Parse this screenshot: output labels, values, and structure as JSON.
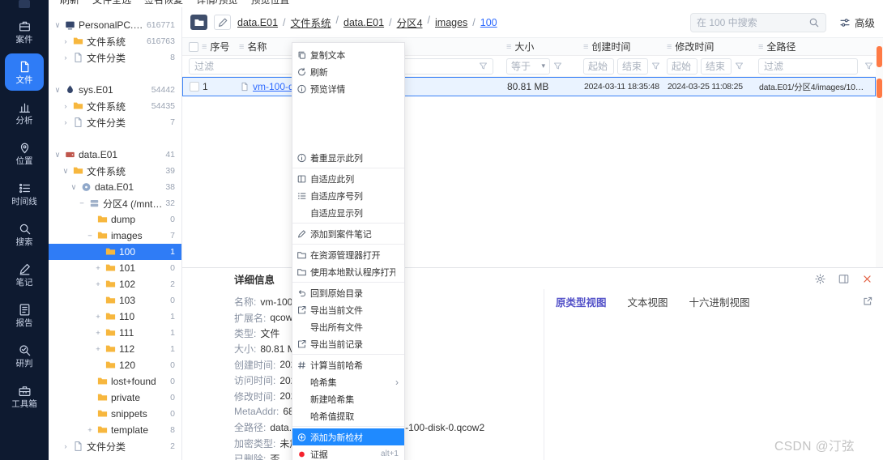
{
  "watermark": "CSDN @汀弦",
  "colors": {
    "accent_blue": "#2f7cf6",
    "menu_highlight": "#1f8aff",
    "link_blue": "#2f6bff",
    "folder_yellow": "#f7b73e",
    "evidence_red": "#f5222d",
    "scrollbar_orange": "#ff7a45",
    "tab_purple": "#5553c9",
    "rail_bg": "#0e1a30"
  },
  "top_toolbar": {
    "items": [
      {
        "label": "刷新"
      },
      {
        "label": "文件全选"
      },
      {
        "label": "签名恢复"
      },
      {
        "label": "详情/预览"
      },
      {
        "label": "预览位置"
      }
    ]
  },
  "rail": {
    "items": [
      {
        "label": "案件",
        "icon": "case-icon"
      },
      {
        "label": "文件",
        "icon": "file-icon",
        "active": true
      },
      {
        "label": "分析",
        "icon": "analysis-icon"
      },
      {
        "label": "位置",
        "icon": "location-icon"
      },
      {
        "label": "时间线",
        "icon": "timeline-icon"
      },
      {
        "label": "搜索",
        "icon": "search-icon"
      },
      {
        "label": "笔记",
        "icon": "note-icon"
      },
      {
        "label": "报告",
        "icon": "report-icon"
      },
      {
        "label": "研判",
        "icon": "judge-icon"
      },
      {
        "label": "工具箱",
        "icon": "toolbox-icon"
      }
    ]
  },
  "tree": {
    "nodes": [
      {
        "exp": "∨",
        "icon": "computer-icon",
        "label": "PersonalPC.E01",
        "count": "616771",
        "depth": 0
      },
      {
        "exp": "›",
        "icon": "folder-icon",
        "label": "文件系统",
        "count": "616763",
        "depth": 1
      },
      {
        "exp": "›",
        "icon": "doc-icon",
        "label": "文件分类",
        "count": "8",
        "depth": 1
      },
      {
        "exp": "∨",
        "icon": "drop-icon",
        "label": "sys.E01",
        "count": "54442",
        "depth": 0,
        "gap": true
      },
      {
        "exp": "›",
        "icon": "folder-icon",
        "label": "文件系统",
        "count": "54435",
        "depth": 1
      },
      {
        "exp": "›",
        "icon": "doc-icon",
        "label": "文件分类",
        "count": "7",
        "depth": 1
      },
      {
        "exp": "∨",
        "icon": "drive-red-icon",
        "label": "data.E01",
        "count": "41",
        "depth": 0,
        "gap": true
      },
      {
        "exp": "∨",
        "icon": "folder-icon",
        "label": "文件系统",
        "count": "39",
        "depth": 1
      },
      {
        "exp": "∨",
        "icon": "cd-icon",
        "label": "data.E01",
        "count": "38",
        "depth": 2
      },
      {
        "exp": "−",
        "icon": "partition-icon",
        "label": "分区4 (/mnt/p...",
        "count": "32",
        "depth": 3
      },
      {
        "exp": "",
        "icon": "folder-icon",
        "label": "dump",
        "count": "0",
        "depth": 4
      },
      {
        "exp": "−",
        "icon": "folder-icon",
        "label": "images",
        "count": "7",
        "depth": 4
      },
      {
        "exp": "",
        "icon": "folder-icon",
        "label": "100",
        "count": "1",
        "depth": 5,
        "selected": true
      },
      {
        "exp": "+",
        "icon": "folder-icon",
        "label": "101",
        "count": "0",
        "depth": 5
      },
      {
        "exp": "+",
        "icon": "folder-icon",
        "label": "102",
        "count": "2",
        "depth": 5
      },
      {
        "exp": "",
        "icon": "folder-icon",
        "label": "103",
        "count": "0",
        "depth": 5
      },
      {
        "exp": "+",
        "icon": "folder-icon",
        "label": "110",
        "count": "1",
        "depth": 5
      },
      {
        "exp": "+",
        "icon": "folder-icon",
        "label": "111",
        "count": "1",
        "depth": 5
      },
      {
        "exp": "+",
        "icon": "folder-icon",
        "label": "112",
        "count": "1",
        "depth": 5
      },
      {
        "exp": "",
        "icon": "folder-icon",
        "label": "120",
        "count": "0",
        "depth": 5
      },
      {
        "exp": "",
        "icon": "folder-icon",
        "label": "lost+found",
        "count": "0",
        "depth": 4
      },
      {
        "exp": "",
        "icon": "folder-icon",
        "label": "private",
        "count": "0",
        "depth": 4
      },
      {
        "exp": "",
        "icon": "folder-icon",
        "label": "snippets",
        "count": "0",
        "depth": 4
      },
      {
        "exp": "+",
        "icon": "folder-icon",
        "label": "template",
        "count": "8",
        "depth": 4
      },
      {
        "exp": "›",
        "icon": "doc-icon",
        "label": "文件分类",
        "count": "2",
        "depth": 1
      }
    ]
  },
  "breadcrumb": {
    "segments": [
      {
        "label": "data.E01"
      },
      {
        "label": "文件系统"
      },
      {
        "label": "data.E01"
      },
      {
        "label": "分区4"
      },
      {
        "label": "images"
      },
      {
        "label": "100",
        "active": true
      }
    ]
  },
  "search": {
    "placeholder": "在 100 中搜索",
    "advanced_label": "高级"
  },
  "table": {
    "columns": [
      "序号",
      "名称",
      "大小",
      "创建时间",
      "修改时间",
      "全路径"
    ],
    "filters": {
      "name": "过滤",
      "size_op": "等于",
      "created_start": "起始",
      "created_end": "结束",
      "modified_start": "起始",
      "modified_end": "结束",
      "path": "过滤"
    },
    "rows": [
      {
        "index": "1",
        "name": "vm-100-disk-0.qcow2",
        "size": "80.81 MB",
        "created": "2024-03-11 18:35:48",
        "modified": "2024-03-25 11:08:25",
        "path": "data.E01/分区4/images/100/vm-100-d..."
      }
    ]
  },
  "context_menu": {
    "items": [
      {
        "icon": "copy-icon",
        "label": "复制文本"
      },
      {
        "icon": "refresh-icon",
        "label": "刷新"
      },
      {
        "icon": "info-icon",
        "label": "预览详情"
      },
      {
        "spacer": true
      },
      {
        "icon": "info-icon",
        "label": "着重显示此列"
      },
      {
        "sep": true
      },
      {
        "icon": "fit-icon",
        "label": "自适应此列"
      },
      {
        "icon": "listnum-icon",
        "label": "自适应序号列"
      },
      {
        "icon": "",
        "label": "自适应显示列"
      },
      {
        "sep": true
      },
      {
        "icon": "pencil-icon",
        "label": "添加到案件笔记"
      },
      {
        "sep": true
      },
      {
        "icon": "folder-open-icon",
        "label": "在资源管理器打开"
      },
      {
        "icon": "folder-open-icon",
        "label": "使用本地默认程序打开"
      },
      {
        "sep": true
      },
      {
        "icon": "undo-icon",
        "label": "回到原始目录"
      },
      {
        "icon": "export-icon",
        "label": "导出当前文件"
      },
      {
        "icon": "",
        "label": "导出所有文件"
      },
      {
        "icon": "export-icon",
        "label": "导出当前记录"
      },
      {
        "sep": true
      },
      {
        "icon": "hash-icon",
        "label": "计算当前哈希"
      },
      {
        "icon": "",
        "label": "哈希集",
        "submenu": true
      },
      {
        "icon": "",
        "label": "新建哈希集"
      },
      {
        "icon": "",
        "label": "哈希值提取"
      },
      {
        "sep": true
      },
      {
        "icon": "target-icon",
        "label": "添加为新检材",
        "highlight": true
      },
      {
        "icon": "dot-icon",
        "label": "证据",
        "shortcut": "alt+1"
      }
    ]
  },
  "detail": {
    "title": "详细信息",
    "fields": [
      {
        "label": "名称:",
        "value": "vm-100-disk-0.qcow2"
      },
      {
        "label": "扩展名:",
        "value": "qcow2"
      },
      {
        "label": "类型:",
        "value": "文件"
      },
      {
        "label": "大小:",
        "value": "80.81 MB"
      },
      {
        "label": "创建时间:",
        "value": "2024-03-11 18:35:48"
      },
      {
        "label": "访问时间:",
        "value": "2024-03-25 11:08:25"
      },
      {
        "label": "修改时间:",
        "value": "2024-03-25 11:08:25"
      },
      {
        "label": "MetaAddr:",
        "value": "6815746"
      },
      {
        "label": "全路径:",
        "value": "data.E01/分区4/images/100/vm-100-disk-0.qcow2"
      },
      {
        "label": "加密类型:",
        "value": "未加密"
      },
      {
        "label": "已删除:",
        "value": "否"
      }
    ]
  },
  "preview": {
    "tabs": [
      {
        "label": "原类型视图",
        "active": true
      },
      {
        "label": "文本视图"
      },
      {
        "label": "十六进制视图"
      }
    ]
  }
}
